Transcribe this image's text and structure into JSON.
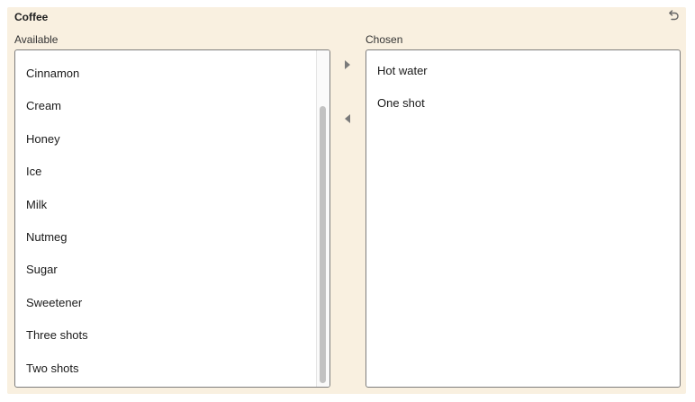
{
  "panel": {
    "title": "Coffee",
    "reset_icon": "undo-icon"
  },
  "available": {
    "label": "Available",
    "items": [
      "Cinnamon",
      "Cream",
      "Honey",
      "Ice",
      "Milk",
      "Nutmeg",
      "Sugar",
      "Sweetener",
      "Three shots",
      "Two shots"
    ]
  },
  "chosen": {
    "label": "Chosen",
    "items": [
      "Hot water",
      "One shot"
    ]
  },
  "controls": {
    "move_right_icon": "triangle-right-icon",
    "move_left_icon": "triangle-left-icon"
  },
  "colors": {
    "panel_background": "#f9f0e0",
    "list_border": "#7d7d7d",
    "scroll_thumb": "#c2c2c2",
    "arrow": "#7a7a7a"
  }
}
